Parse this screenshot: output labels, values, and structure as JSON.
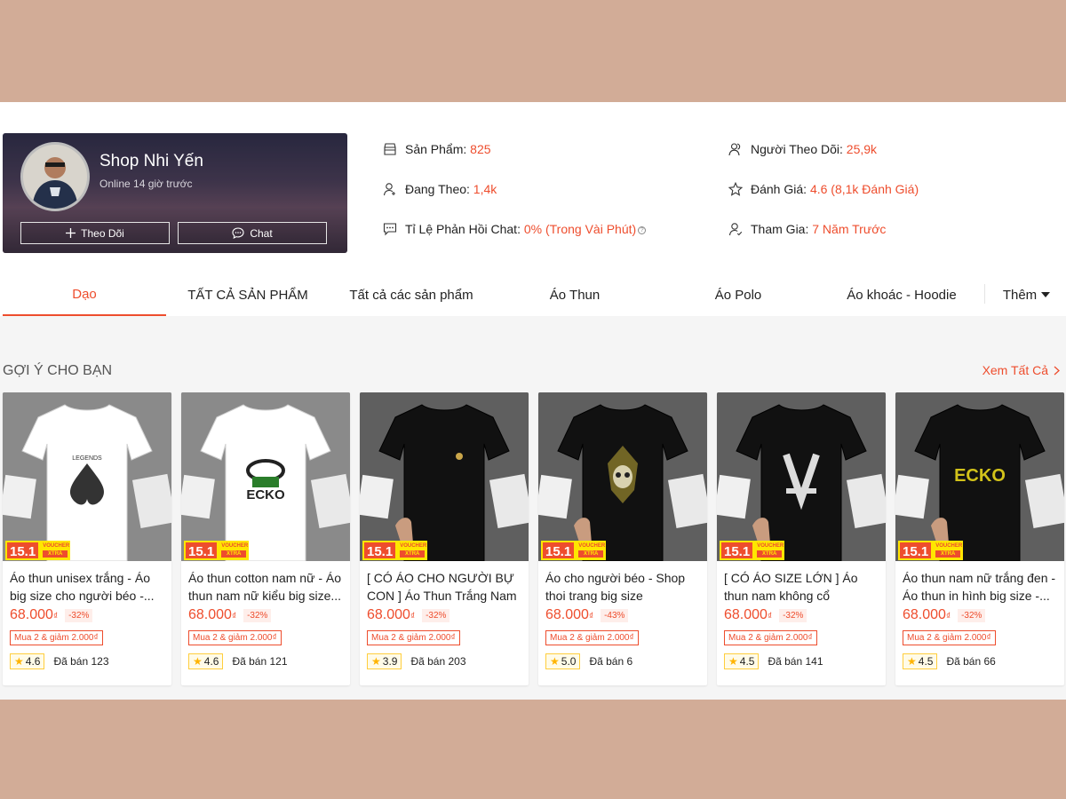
{
  "shop": {
    "name": "Shop Nhi Yến",
    "online": "Online 14 giờ trước",
    "follow_label": "Theo Dõi",
    "chat_label": "Chat"
  },
  "stats": {
    "products_label": "Sản Phẩm:",
    "products_value": "825",
    "following_label": "Đang Theo:",
    "following_value": "1,4k",
    "chat_rate_label": "Tỉ Lệ Phản Hồi Chat:",
    "chat_rate_value": "0% (Trong Vài Phút)",
    "followers_label": "Người Theo Dõi:",
    "followers_value": "25,9k",
    "rating_label": "Đánh Giá:",
    "rating_value": "4.6 (8,1k Đánh Giá)",
    "joined_label": "Tham Gia:",
    "joined_value": "7 Năm Trước"
  },
  "tabs": [
    {
      "label": "Dạo"
    },
    {
      "label": "TẤT CẢ SẢN PHẨM"
    },
    {
      "label": "Tất cả các sản phẩm"
    },
    {
      "label": "Áo Thun"
    },
    {
      "label": "Áo Polo"
    },
    {
      "label": "Áo khoác - Hoodie"
    },
    {
      "label": "Thêm"
    }
  ],
  "recommend": {
    "title": "GỢI Ý CHO BẠN",
    "see_all": "Xem Tất Cả"
  },
  "badge": {
    "main": "15.1",
    "voucher": "VOUCHER",
    "xtra": "XTRA"
  },
  "products": [
    {
      "name": "Áo thun unisex trắng - Áo big size cho người béo -...",
      "price": "68.000",
      "currency": "₫",
      "discount": "-32%",
      "promo": "Mua 2 & giảm 2.000₫",
      "rating": "4.6",
      "sold": "Đã bán 123",
      "shirt_color": "#ffffff",
      "print": "ace-spade"
    },
    {
      "name": "Áo thun cotton nam nữ - Áo thun nam nữ kiểu big size...",
      "price": "68.000",
      "currency": "₫",
      "discount": "-32%",
      "promo": "Mua 2 & giảm 2.000₫",
      "rating": "4.6",
      "sold": "Đã bán 121",
      "shirt_color": "#ffffff",
      "print": "ecko"
    },
    {
      "name": "[ CÓ ÁO CHO NGƯỜI BỰ CON ] Áo Thun Trắng Nam",
      "price": "68.000",
      "currency": "₫",
      "discount": "-32%",
      "promo": "Mua 2 & giảm 2.000₫",
      "rating": "3.9",
      "sold": "Đã bán 203",
      "shirt_color": "#111111",
      "print": "small-logo"
    },
    {
      "name": "Áo cho người béo - Shop thoi trang big size",
      "price": "68.000",
      "currency": "₫",
      "discount": "-43%",
      "promo": "Mua 2 & giảm 2.000₫",
      "rating": "5.0",
      "sold": "Đã bán 6",
      "shirt_color": "#111111",
      "print": "skull"
    },
    {
      "name": "[ CÓ ÁO SIZE LỚN ] Áo thun nam không cổ",
      "price": "68.000",
      "currency": "₫",
      "discount": "-32%",
      "promo": "Mua 2 & giảm 2.000₫",
      "rating": "4.5",
      "sold": "Đã bán 141",
      "shirt_color": "#111111",
      "print": "lv"
    },
    {
      "name": "Áo thun nam nữ trắng đen - Áo thun in hình big size -...",
      "price": "68.000",
      "currency": "₫",
      "discount": "-32%",
      "promo": "Mua 2 & giảm 2.000₫",
      "rating": "4.5",
      "sold": "Đã bán 66",
      "shirt_color": "#111111",
      "print": "ecko-yellow"
    }
  ],
  "colors": {
    "accent": "#ee4d2d",
    "background": "#d2ac97"
  }
}
